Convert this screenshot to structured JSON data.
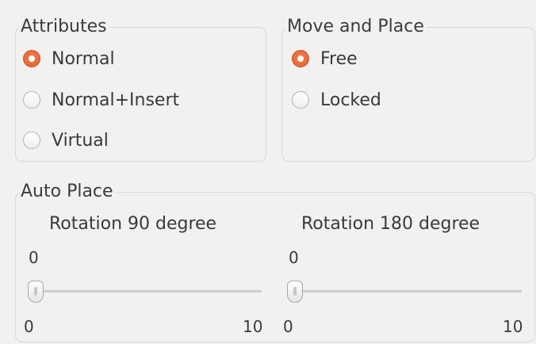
{
  "attributes": {
    "title": "Attributes",
    "options": [
      {
        "label": "Normal",
        "checked": true
      },
      {
        "label": "Normal+Insert",
        "checked": false
      },
      {
        "label": "Virtual",
        "checked": false
      }
    ]
  },
  "move_place": {
    "title": "Move and Place",
    "options": [
      {
        "label": "Free",
        "checked": true
      },
      {
        "label": "Locked",
        "checked": false
      }
    ]
  },
  "auto_place": {
    "title": "Auto Place",
    "rot90": {
      "label": "Rotation 90 degree",
      "value": "0",
      "min": "0",
      "max": "10"
    },
    "rot180": {
      "label": "Rotation 180 degree",
      "value": "0",
      "min": "0",
      "max": "10"
    }
  },
  "colors": {
    "accent": "#e46a38",
    "background": "#f2f1ef",
    "border": "#d9d8d6"
  }
}
